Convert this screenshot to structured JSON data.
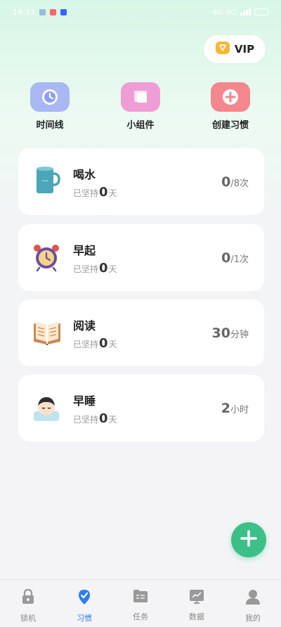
{
  "status_bar": {
    "time": "14:33",
    "right_text": "4G 5G"
  },
  "vip": {
    "label": "VIP"
  },
  "quick_actions": [
    {
      "label": "时间线",
      "icon": "clock-icon",
      "color": "#a9b8f3"
    },
    {
      "label": "小组件",
      "icon": "widget-icon",
      "color": "#ee9ed4"
    },
    {
      "label": "创建习惯",
      "icon": "plus-icon",
      "color": "#f4878d"
    }
  ],
  "habits": [
    {
      "name": "喝水",
      "streak_prefix": "已坚持",
      "streak_value": "0",
      "streak_suffix": "天",
      "goal_value": "0",
      "goal_unit": "/8次",
      "icon": "cup-icon"
    },
    {
      "name": "早起",
      "streak_prefix": "已坚持",
      "streak_value": "0",
      "streak_suffix": "天",
      "goal_value": "0",
      "goal_unit": "/1次",
      "icon": "alarm-clock-icon"
    },
    {
      "name": "阅读",
      "streak_prefix": "已坚持",
      "streak_value": "0",
      "streak_suffix": "天",
      "goal_value": "30",
      "goal_unit": "分钟",
      "icon": "book-icon"
    },
    {
      "name": "早睡",
      "streak_prefix": "已坚持",
      "streak_value": "0",
      "streak_suffix": "天",
      "goal_value": "2",
      "goal_unit": "小时",
      "icon": "sleeping-person-icon"
    }
  ],
  "fab": {
    "icon": "plus-icon",
    "color": "#3cc088"
  },
  "nav": [
    {
      "label": "锁机",
      "icon": "lock-icon",
      "active": false
    },
    {
      "label": "习惯",
      "icon": "location-check-icon",
      "active": true
    },
    {
      "label": "任务",
      "icon": "task-folder-icon",
      "active": false
    },
    {
      "label": "数据",
      "icon": "chart-icon",
      "active": false
    },
    {
      "label": "我的",
      "icon": "user-icon",
      "active": false
    }
  ],
  "colors": {
    "accent": "#2e7cf6",
    "fab": "#3cc088",
    "inactive": "#888888"
  }
}
